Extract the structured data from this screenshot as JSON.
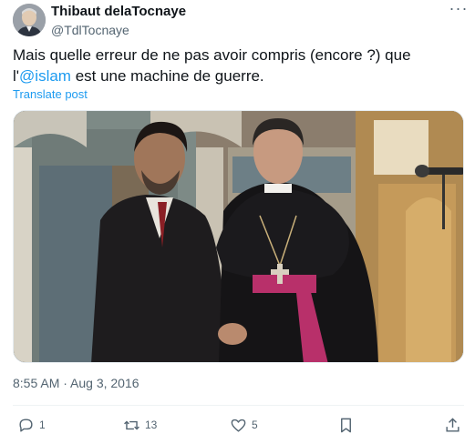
{
  "author": {
    "display_name": "Thibaut delaTocnaye",
    "handle": "@TdlTocnaye",
    "avatar_icon": "profile-photo"
  },
  "tweet": {
    "text_before": "Mais quelle erreur de ne pas avoir compris (encore ?) que l'",
    "mention": "@islam",
    "text_after": " est une machine de guerre.",
    "translate_label": "Translate post",
    "timestamp": "8:55 AM · Aug 3, 2016"
  },
  "actions": {
    "reply_count": "1",
    "retweet_count": "13",
    "like_count": "5"
  },
  "colors": {
    "link": "#1d9bf0",
    "muted": "#536471",
    "text": "#0f1419"
  }
}
